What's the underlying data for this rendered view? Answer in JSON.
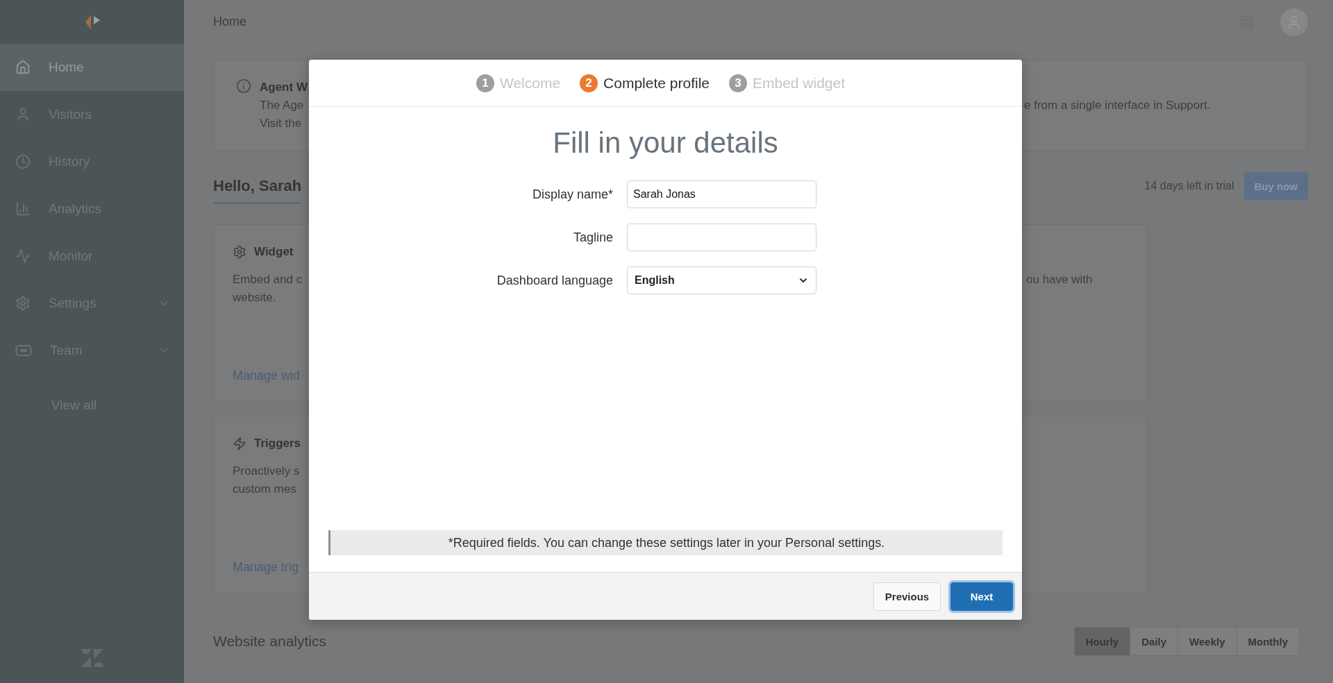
{
  "sidebar": {
    "items": [
      {
        "kind": "home",
        "label": "Home",
        "selected": true,
        "expandable": false
      },
      {
        "kind": "visitors",
        "label": "Visitors",
        "selected": false,
        "expandable": false
      },
      {
        "kind": "history",
        "label": "History",
        "selected": false,
        "expandable": false
      },
      {
        "kind": "analytics",
        "label": "Analytics",
        "selected": false,
        "expandable": false
      },
      {
        "kind": "monitor",
        "label": "Monitor",
        "selected": false,
        "expandable": false
      },
      {
        "kind": "settings",
        "label": "Settings",
        "selected": false,
        "expandable": true
      },
      {
        "kind": "team",
        "label": "Team",
        "selected": false,
        "expandable": true
      }
    ],
    "view_all": "View all"
  },
  "header": {
    "title": "Home"
  },
  "banner": {
    "title": "Agent W",
    "lines": [
      {
        "left": "The Age",
        "right": "e from a single interface in Support."
      },
      {
        "left": "Visit the"
      }
    ]
  },
  "greeting": "Hello, Sarah",
  "trial": "14 days left in trial",
  "buy_button": "Buy now",
  "cards": [
    {
      "kind": "gear",
      "title": "Widget",
      "lines": [
        {
          "left": "Embed and c",
          "right": "ou have with"
        },
        {
          "left": "website."
        }
      ],
      "link": "Manage wid"
    },
    {
      "kind": "bolt",
      "title": "Triggers",
      "lines": [
        {
          "left": "Proactively s"
        },
        {
          "left": "custom mes"
        }
      ],
      "link": "Manage trig"
    }
  ],
  "analytics": {
    "title": "Website analytics",
    "tabs": [
      {
        "label": "Hourly",
        "selected": true
      },
      {
        "label": "Daily",
        "selected": false
      },
      {
        "label": "Weekly",
        "selected": false
      },
      {
        "label": "Monthly",
        "selected": false
      }
    ]
  },
  "modal": {
    "steps": [
      {
        "number": "1",
        "label": "Welcome",
        "selected": false
      },
      {
        "number": "2",
        "label": "Complete profile",
        "selected": true
      },
      {
        "number": "3",
        "label": "Embed widget",
        "selected": false
      }
    ],
    "title": "Fill in your details",
    "fields": [
      {
        "kind": "text",
        "label": "Display name*",
        "value": "Sarah Jonas"
      },
      {
        "kind": "text",
        "label": "Tagline"
      },
      {
        "kind": "select",
        "label": "Dashboard language",
        "value": "English"
      }
    ],
    "note": "*Required fields. You can change these settings later in your Personal settings.",
    "buttons": [
      {
        "kind": "secondary",
        "label": "Previous"
      },
      {
        "kind": "primary",
        "label": "Next"
      }
    ]
  }
}
